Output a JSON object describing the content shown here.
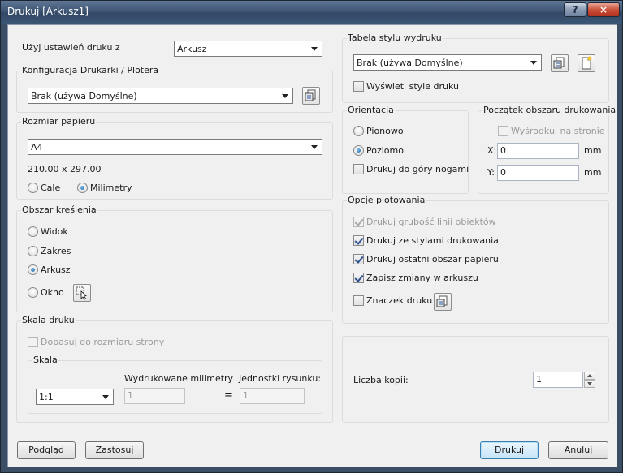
{
  "window": {
    "title": "Drukuj [Arkusz1]",
    "help_glyph": "?",
    "close_glyph": "×"
  },
  "use_settings": {
    "label": "Użyj ustawień druku z",
    "value": "Arkusz"
  },
  "printer": {
    "legend": "Konfiguracja Drukarki / Plotera",
    "value": "Brak (używa Domyślne)"
  },
  "paper": {
    "legend": "Rozmiar papieru",
    "value": "A4",
    "dimensions": "210.00 x 297.00",
    "units": [
      {
        "label": "Cale",
        "selected": false
      },
      {
        "label": "Milimetry",
        "selected": true
      }
    ]
  },
  "plot_area": {
    "legend": "Obszar kreślenia",
    "options": [
      {
        "label": "Widok",
        "selected": false
      },
      {
        "label": "Zakres",
        "selected": false
      },
      {
        "label": "Arkusz",
        "selected": true
      },
      {
        "label": "Okno",
        "selected": false
      }
    ]
  },
  "scale": {
    "legend": "Skala druku",
    "fit_label": "Dopasuj do rozmiaru strony",
    "inner_legend": "Skala",
    "value": "1:1",
    "mm_label": "Wydrukowane milimetry",
    "mm_value": "1",
    "equals": "=",
    "units_label": "Jednostki rysunku:",
    "units_value": "1"
  },
  "style_table": {
    "legend": "Tabela stylu wydruku",
    "value": "Brak (używa Domyślne)",
    "show_styles_label": "Wyświetl style druku"
  },
  "orientation": {
    "legend": "Orientacja",
    "options": [
      {
        "label": "Pionowo",
        "selected": false
      },
      {
        "label": "Poziomo",
        "selected": true
      }
    ],
    "upside_down_label": "Drukuj do góry nogami"
  },
  "origin": {
    "legend": "Początek obszaru drukowania",
    "center_label": "Wyśrodkuj na stronie",
    "x_label": "X:",
    "x_value": "0",
    "y_label": "Y:",
    "y_value": "0",
    "unit": "mm"
  },
  "plot_options": {
    "legend": "Opcje plotowania",
    "options": [
      {
        "label": "Drukuj grubość linii obiektów",
        "checked": true,
        "disabled": true
      },
      {
        "label": "Drukuj ze stylami drukowania",
        "checked": true,
        "disabled": false
      },
      {
        "label": "Drukuj ostatni obszar papieru",
        "checked": true,
        "disabled": false
      },
      {
        "label": "Zapisz zmiany w arkuszu",
        "checked": true,
        "disabled": false
      },
      {
        "label": "Znaczek druku",
        "checked": false,
        "disabled": false
      }
    ]
  },
  "copies": {
    "label": "Liczba kopii:",
    "value": "1"
  },
  "buttons": {
    "preview": "Podgląd",
    "apply": "Zastosuj",
    "print": "Drukuj",
    "cancel": "Anuluj"
  }
}
